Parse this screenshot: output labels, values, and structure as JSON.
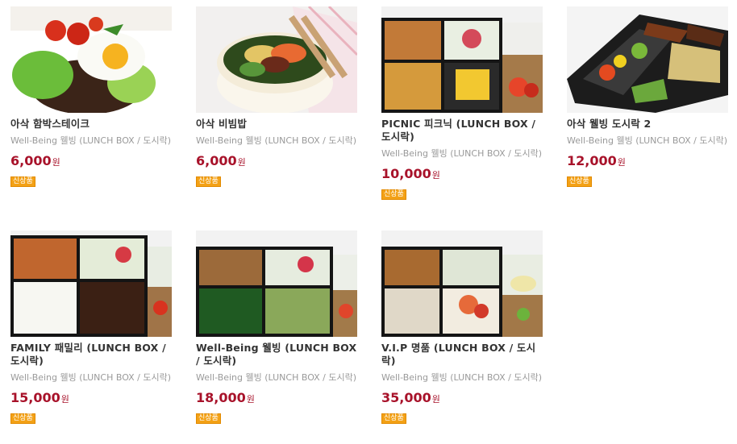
{
  "products": [
    {
      "name": "아삭 함박스테이크",
      "desc": "Well-Being 웰빙 (LUNCH BOX / 도시락)",
      "price": "6,000",
      "unit": "원",
      "badge": "신상품",
      "image": "hamburg-steak-photo"
    },
    {
      "name": "아삭 비빔밥",
      "desc": "Well-Being 웰빙 (LUNCH BOX / 도시락)",
      "price": "6,000",
      "unit": "원",
      "badge": "신상품",
      "image": "bibimbap-photo"
    },
    {
      "name": "PICNIC 피크닉 (LUNCH BOX / 도시락)",
      "desc": "Well-Being 웰빙 (LUNCH BOX / 도시락)",
      "price": "10,000",
      "unit": "원",
      "badge": "신상품",
      "image": "picnic-box-photo"
    },
    {
      "name": "아삭 웰빙 도시락 2",
      "desc": "Well-Being 웰빙 (LUNCH BOX / 도시락)",
      "price": "12,000",
      "unit": "원",
      "badge": "신상품",
      "image": "wellbeing-box-photo"
    },
    {
      "name": "FAMILY 패밀리 (LUNCH BOX / 도시락)",
      "desc": "Well-Being 웰빙 (LUNCH BOX / 도시락)",
      "price": "15,000",
      "unit": "원",
      "badge": "신상품",
      "image": "family-box-photo"
    },
    {
      "name": "Well-Being 웰빙 (LUNCH BOX / 도시락)",
      "desc": "Well-Being 웰빙 (LUNCH BOX / 도시락)",
      "price": "18,000",
      "unit": "원",
      "badge": "신상품",
      "image": "wellbeing-lunchbox-photo"
    },
    {
      "name": "V.I.P 명품 (LUNCH BOX / 도시락)",
      "desc": "Well-Being 웰빙 (LUNCH BOX / 도시락)",
      "price": "35,000",
      "unit": "원",
      "badge": "신상품",
      "image": "vip-box-photo"
    }
  ]
}
